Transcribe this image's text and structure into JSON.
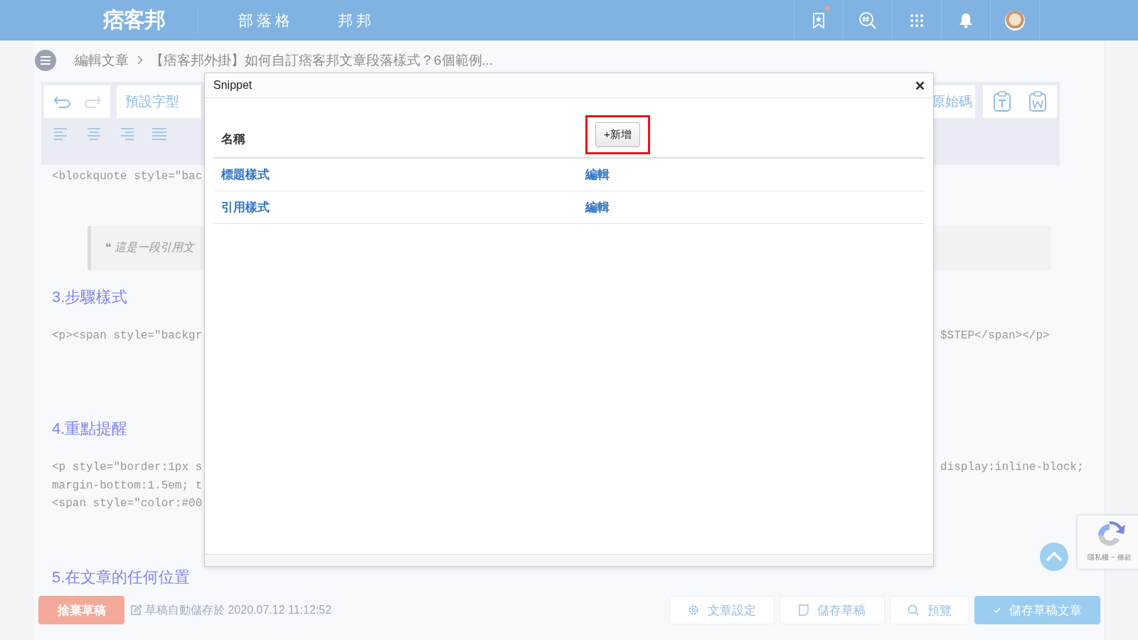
{
  "topbar": {
    "logo": "痞客邦",
    "nav": [
      {
        "label": "部落格"
      },
      {
        "label": "邦邦"
      }
    ],
    "notification_dot": true
  },
  "breadcrumb": {
    "items": [
      "編輯文章",
      "【痞客邦外掛】如何自訂痞客邦文章段落樣式？6個範例..."
    ]
  },
  "toolbar": {
    "font_select": "預設字型",
    "source_button": "原始碼"
  },
  "editor": {
    "blocks": [
      {
        "kind": "code",
        "left": [
          "<blockquote style=\"bac"
        ]
      },
      {
        "kind": "quote",
        "text": "❝ 這是一段引用文"
      },
      {
        "kind": "heading",
        "text": "3.步驟樣式"
      },
      {
        "kind": "code",
        "left": [
          "<p><span style=\"backgr"
        ],
        "right": "$STEP</span></p>"
      },
      {
        "kind": "heading",
        "text": "4.重點提醒"
      },
      {
        "kind": "code",
        "left": [
          "<p style=\"border:1px s",
          "margin-bottom:1.5em; t",
          "<span style=\"color:#00"
        ],
        "right": "display:inline-block;"
      },
      {
        "kind": "heading",
        "text": "5.在文章的任何位置"
      }
    ]
  },
  "modal": {
    "title": "Snippet",
    "column": "名稱",
    "add_button": "+新增",
    "add_highlighted": true,
    "rows": [
      {
        "name": "標題樣式",
        "action": "編輯"
      },
      {
        "name": "引用樣式",
        "action": "編輯"
      }
    ]
  },
  "footer": {
    "discard": "捨棄草稿",
    "autosave": "草稿自動儲存於 2020.07.12 11:12:52",
    "buttons": [
      {
        "label": "文章設定",
        "kind": "settings"
      },
      {
        "label": "儲存草稿",
        "kind": "draft"
      },
      {
        "label": "預覽",
        "kind": "preview"
      },
      {
        "label": "儲存草稿文章",
        "kind": "publish"
      }
    ]
  },
  "recaptcha": {
    "text": "隱私權 − 條款"
  }
}
